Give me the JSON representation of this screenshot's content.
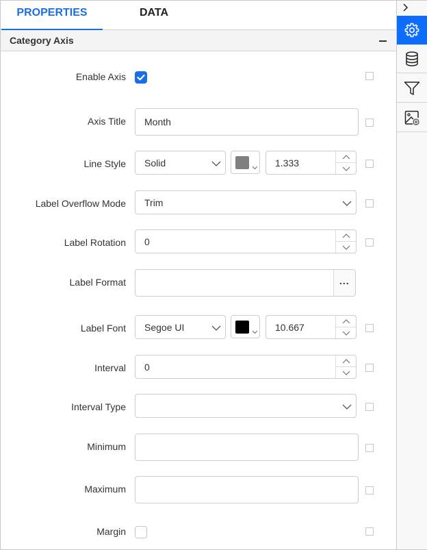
{
  "tabs": [
    {
      "label": "PROPERTIES",
      "active": true
    },
    {
      "label": "DATA",
      "active": false
    }
  ],
  "section": {
    "title": "Category Axis",
    "collapse_icon": "minus-icon"
  },
  "fields": {
    "enable_axis": {
      "label": "Enable Axis",
      "checked": true
    },
    "axis_title": {
      "label": "Axis Title",
      "value": "Month"
    },
    "line_style": {
      "label": "Line Style",
      "style": "Solid",
      "color": "#808080",
      "width": "1.333"
    },
    "label_overflow_mode": {
      "label": "Label Overflow Mode",
      "value": "Trim"
    },
    "label_rotation": {
      "label": "Label Rotation",
      "value": "0"
    },
    "label_format": {
      "label": "Label Format",
      "value": "",
      "button": "..."
    },
    "label_font": {
      "label": "Label Font",
      "family": "Segoe UI",
      "color": "#000000",
      "size": "10.667"
    },
    "interval": {
      "label": "Interval",
      "value": "0"
    },
    "interval_type": {
      "label": "Interval Type",
      "value": ""
    },
    "minimum": {
      "label": "Minimum",
      "value": ""
    },
    "maximum": {
      "label": "Maximum",
      "value": ""
    },
    "margin": {
      "label": "Margin",
      "checked": false
    }
  },
  "sidebar": {
    "expand_icon": "chevron-right-icon",
    "items": [
      {
        "icon": "gear-icon",
        "active": true
      },
      {
        "icon": "database-icon",
        "active": false
      },
      {
        "icon": "filter-icon",
        "active": false
      },
      {
        "icon": "image-settings-icon",
        "active": false
      }
    ]
  },
  "colors": {
    "accent": "#1a6ee8",
    "sidebar_active": "#0d6efd"
  }
}
